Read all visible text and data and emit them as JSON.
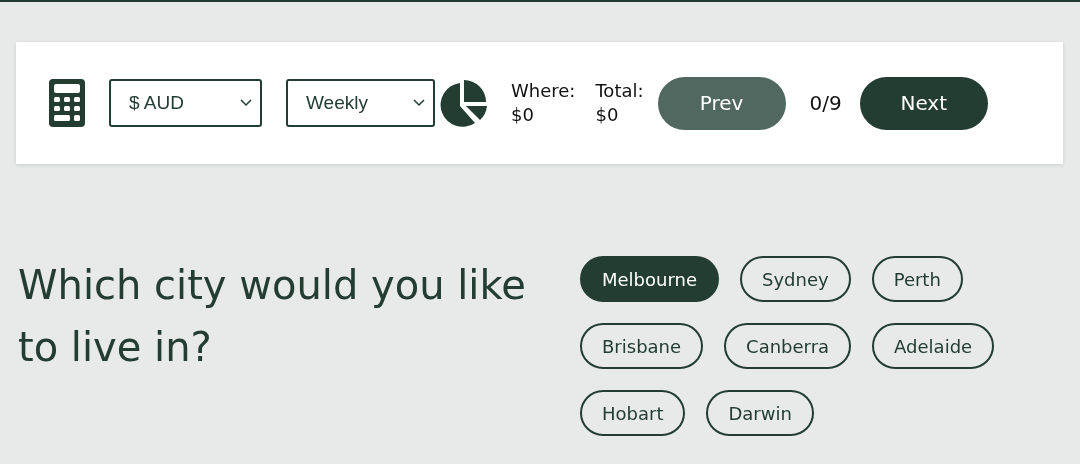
{
  "toolbar": {
    "currency": {
      "value": "$ AUD"
    },
    "frequency": {
      "value": "Weekly"
    },
    "stats": [
      {
        "label": "Where:",
        "value": "$0"
      },
      {
        "label": "Total:",
        "value": "$0"
      }
    ],
    "prev": {
      "label": "Prev",
      "disabled": true
    },
    "progress": "0/9",
    "next": {
      "label": "Next",
      "disabled": false
    }
  },
  "question": "Which city would you like to live in?",
  "options": [
    {
      "label": "Melbourne",
      "selected": true
    },
    {
      "label": "Sydney",
      "selected": false
    },
    {
      "label": "Perth",
      "selected": false
    },
    {
      "label": "Brisbane",
      "selected": false
    },
    {
      "label": "Canberra",
      "selected": false
    },
    {
      "label": "Adelaide",
      "selected": false
    },
    {
      "label": "Hobart",
      "selected": false
    },
    {
      "label": "Darwin",
      "selected": false
    }
  ]
}
